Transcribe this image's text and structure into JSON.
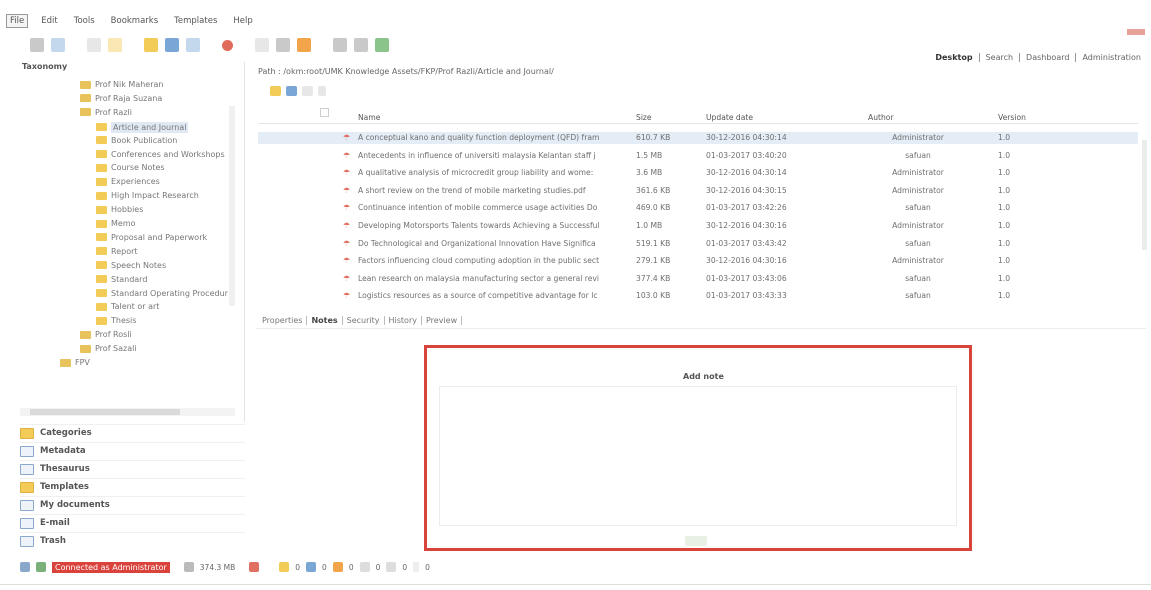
{
  "menu": [
    "File",
    "Edit",
    "Tools",
    "Bookmarks",
    "Templates",
    "Help"
  ],
  "view_tabs": [
    "Desktop",
    "Search",
    "Dashboard",
    "Administration"
  ],
  "taxonomy": {
    "title": "Taxonomy",
    "items": [
      {
        "label": "Prof Nik Maheran",
        "level": 2
      },
      {
        "label": "Prof Raja Suzana",
        "level": 2
      },
      {
        "label": "Prof Razli",
        "level": 2
      },
      {
        "label": "Article and Journal",
        "level": 3,
        "selected": true
      },
      {
        "label": "Book Publication",
        "level": 3
      },
      {
        "label": "Conferences and Workshops",
        "level": 3
      },
      {
        "label": "Course Notes",
        "level": 3
      },
      {
        "label": "Experiences",
        "level": 3
      },
      {
        "label": "High Impact Research",
        "level": 3
      },
      {
        "label": "Hobbies",
        "level": 3
      },
      {
        "label": "Memo",
        "level": 3
      },
      {
        "label": "Proposal and Paperwork",
        "level": 3
      },
      {
        "label": "Report",
        "level": 3
      },
      {
        "label": "Speech Notes",
        "level": 3
      },
      {
        "label": "Standard",
        "level": 3
      },
      {
        "label": "Standard Operating Procedur",
        "level": 3
      },
      {
        "label": "Talent or art",
        "level": 3
      },
      {
        "label": "Thesis",
        "level": 3
      },
      {
        "label": "Prof Rosli",
        "level": 2
      },
      {
        "label": "Prof Sazali",
        "level": 2
      },
      {
        "label": "FPV",
        "level": 1
      }
    ]
  },
  "accordion": [
    "Categories",
    "Metadata",
    "Thesaurus",
    "Templates",
    "My documents",
    "E-mail",
    "Trash"
  ],
  "path": "Path : /okm:root/UMK Knowledge Assets/FKP/Prof Razli/Article and Journal/",
  "table": {
    "columns": [
      "Name",
      "Size",
      "Update date",
      "Author",
      "Version"
    ],
    "rows": [
      {
        "name": "A conceptual kano and quality function deployment (QFD) fram",
        "size": "610.7 KB",
        "date": "30-12-2016 04:30:14",
        "author": "Administrator",
        "version": "1.0"
      },
      {
        "name": "Antecedents in influence of universiti malaysia Kelantan staff j",
        "size": "1.5 MB",
        "date": "01-03-2017 03:40:20",
        "author": "safuan",
        "version": "1.0"
      },
      {
        "name": "A qualitative analysis of microcredit group liability and wome:",
        "size": "3.6 MB",
        "date": "30-12-2016 04:30:14",
        "author": "Administrator",
        "version": "1.0"
      },
      {
        "name": "A short review on the trend of mobile marketing studies.pdf",
        "size": "361.6 KB",
        "date": "30-12-2016 04:30:15",
        "author": "Administrator",
        "version": "1.0"
      },
      {
        "name": "Continuance intention of mobile commerce usage activities Do",
        "size": "469.0 KB",
        "date": "01-03-2017 03:42:26",
        "author": "safuan",
        "version": "1.0"
      },
      {
        "name": "Developing Motorsports Talents towards Achieving a Successful",
        "size": "1.0 MB",
        "date": "30-12-2016 04:30:16",
        "author": "Administrator",
        "version": "1.0"
      },
      {
        "name": "Do Technological and Organizational Innovation Have Significa",
        "size": "519.1 KB",
        "date": "01-03-2017 03:43:42",
        "author": "safuan",
        "version": "1.0"
      },
      {
        "name": "Factors influencing cloud computing adoption in the public sect",
        "size": "279.1 KB",
        "date": "30-12-2016 04:30:16",
        "author": "Administrator",
        "version": "1.0"
      },
      {
        "name": "Lean research on malaysia manufacturing sector a general revi",
        "size": "377.4 KB",
        "date": "01-03-2017 03:43:06",
        "author": "safuan",
        "version": "1.0"
      },
      {
        "name": "Logistics resources as a source of competitive advantage for lc",
        "size": "103.0 KB",
        "date": "01-03-2017 03:43:33",
        "author": "safuan",
        "version": "1.0"
      }
    ]
  },
  "property_tabs": [
    "Properties",
    "Notes",
    "Security",
    "History",
    "Preview"
  ],
  "notes": {
    "add_note": "Add note"
  },
  "status": {
    "connected": "Connected as Administrator",
    "size": "374.3 MB",
    "counts": [
      "0",
      "0",
      "0",
      "0",
      "0",
      "0"
    ]
  }
}
